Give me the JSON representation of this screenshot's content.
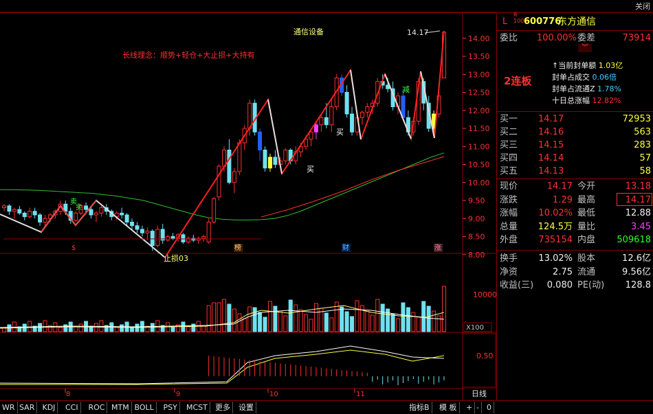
{
  "window": {
    "close_label": "关闭"
  },
  "chart": {
    "sector_label": "通信设备",
    "philosophy_label": "长线理念：顺势+轻仓+大止损+大持有",
    "price_max_label": "14.17",
    "stop_loss_label": "止损03",
    "buy_label_1": "买",
    "buy_label_2": "买",
    "reduce_label": "减",
    "sell_label_1": "卖",
    "sell_label_2": "卖",
    "event_markers": [
      "$",
      "榜",
      "财",
      "涨"
    ],
    "y_ticks": [
      "14.00",
      "13.50",
      "13.00",
      "12.50",
      "12.00",
      "11.50",
      "11.00",
      "10.50",
      "10.00",
      "9.50",
      "9.00",
      "8.50",
      "8.00"
    ],
    "x_ticks": [
      "8",
      "9",
      "10",
      "11"
    ],
    "vol_tick": "10000",
    "vol_unit": "X100",
    "ind_tick": "0.50",
    "period_label": "日线"
  },
  "chart_data": {
    "type": "candlestick",
    "ylim": [
      7.9,
      14.3
    ],
    "candles": [
      [
        9.3,
        9.4,
        9.2,
        9.35
      ],
      [
        9.35,
        9.4,
        9.1,
        9.2
      ],
      [
        9.2,
        9.3,
        9.0,
        9.25
      ],
      [
        9.25,
        9.35,
        9.1,
        9.15
      ],
      [
        9.15,
        9.2,
        8.95,
        9.05
      ],
      [
        9.05,
        9.3,
        9.0,
        9.2
      ],
      [
        9.2,
        9.3,
        9.0,
        9.1
      ],
      [
        9.1,
        9.15,
        8.8,
        8.9
      ],
      [
        8.9,
        9.1,
        8.75,
        9.0
      ],
      [
        9.0,
        9.15,
        8.9,
        9.1
      ],
      [
        9.1,
        9.25,
        9.0,
        9.2
      ],
      [
        9.2,
        9.5,
        9.1,
        9.4
      ],
      [
        9.4,
        9.5,
        9.1,
        9.2
      ],
      [
        9.2,
        9.3,
        8.85,
        8.95
      ],
      [
        8.95,
        9.2,
        8.9,
        9.15
      ],
      [
        9.15,
        9.4,
        9.1,
        9.35
      ],
      [
        9.35,
        9.45,
        9.15,
        9.25
      ],
      [
        9.25,
        9.35,
        9.0,
        9.1
      ],
      [
        9.1,
        9.2,
        8.9,
        9.15
      ],
      [
        9.15,
        9.35,
        9.05,
        9.3
      ],
      [
        9.3,
        9.4,
        9.1,
        9.2
      ],
      [
        9.2,
        9.25,
        8.95,
        9.05
      ],
      [
        9.05,
        9.2,
        8.95,
        9.15
      ],
      [
        9.15,
        9.3,
        9.0,
        9.1
      ],
      [
        9.1,
        9.15,
        8.8,
        8.9
      ],
      [
        8.9,
        9.0,
        8.7,
        8.8
      ],
      [
        8.8,
        8.9,
        8.6,
        8.7
      ],
      [
        8.7,
        8.8,
        8.5,
        8.6
      ],
      [
        8.6,
        8.75,
        8.4,
        8.65
      ],
      [
        8.65,
        8.7,
        8.1,
        8.25
      ],
      [
        8.25,
        8.8,
        8.2,
        8.7
      ],
      [
        8.7,
        8.85,
        8.3,
        8.4
      ],
      [
        8.4,
        8.55,
        8.35,
        8.5
      ],
      [
        8.5,
        8.6,
        8.4,
        8.45
      ],
      [
        8.45,
        8.6,
        8.35,
        8.55
      ],
      [
        8.55,
        8.6,
        8.3,
        8.35
      ],
      [
        8.35,
        8.5,
        8.3,
        8.45
      ],
      [
        8.45,
        8.55,
        8.35,
        8.4
      ],
      [
        8.4,
        8.5,
        8.3,
        8.45
      ],
      [
        8.45,
        8.55,
        8.35,
        8.5
      ],
      [
        8.35,
        9.0,
        8.3,
        8.9
      ],
      [
        8.9,
        9.6,
        8.85,
        9.55
      ],
      [
        9.6,
        10.5,
        9.5,
        10.45
      ],
      [
        10.45,
        11.0,
        10.3,
        10.9
      ],
      [
        10.9,
        11.2,
        9.95,
        10.0
      ],
      [
        10.0,
        10.4,
        9.7,
        10.3
      ],
      [
        10.3,
        11.2,
        10.2,
        11.1
      ],
      [
        11.1,
        11.6,
        10.9,
        11.5
      ],
      [
        11.5,
        12.3,
        11.3,
        12.2
      ],
      [
        12.2,
        12.3,
        11.3,
        11.4
      ],
      [
        11.4,
        11.5,
        10.6,
        10.9
      ],
      [
        10.9,
        11.0,
        10.3,
        10.4
      ],
      [
        10.4,
        10.8,
        10.3,
        10.7
      ],
      [
        10.7,
        10.9,
        10.4,
        10.5
      ],
      [
        10.5,
        10.7,
        10.4,
        10.6
      ],
      [
        10.6,
        10.95,
        10.5,
        10.9
      ],
      [
        10.9,
        10.95,
        10.5,
        10.6
      ],
      [
        10.6,
        11.0,
        10.5,
        10.85
      ],
      [
        10.85,
        11.1,
        10.7,
        11.0
      ],
      [
        11.0,
        11.3,
        10.9,
        11.2
      ],
      [
        11.2,
        11.5,
        11.0,
        11.4
      ],
      [
        11.4,
        11.7,
        11.2,
        11.6
      ],
      [
        11.6,
        11.9,
        11.4,
        11.8
      ],
      [
        11.8,
        12.2,
        11.5,
        11.6
      ],
      [
        11.6,
        12.3,
        11.4,
        12.1
      ],
      [
        12.1,
        13.0,
        12.0,
        12.9
      ],
      [
        12.9,
        13.0,
        12.4,
        12.5
      ],
      [
        12.5,
        12.7,
        11.8,
        11.9
      ],
      [
        11.9,
        12.1,
        11.3,
        11.4
      ],
      [
        11.4,
        11.9,
        11.3,
        11.8
      ],
      [
        11.8,
        12.0,
        11.6,
        11.95
      ],
      [
        11.95,
        12.2,
        11.8,
        12.1
      ],
      [
        12.1,
        12.3,
        11.9,
        12.2
      ],
      [
        12.2,
        12.9,
        12.1,
        12.8
      ],
      [
        12.8,
        13.0,
        12.6,
        12.7
      ],
      [
        12.7,
        12.9,
        12.5,
        12.6
      ],
      [
        12.6,
        12.8,
        12.0,
        12.1
      ],
      [
        12.1,
        12.5,
        11.9,
        12.4
      ],
      [
        12.4,
        12.6,
        11.7,
        11.8
      ],
      [
        11.8,
        12.0,
        11.3,
        11.4
      ],
      [
        11.4,
        11.8,
        11.3,
        11.7
      ],
      [
        11.7,
        12.9,
        11.6,
        12.8
      ],
      [
        12.8,
        12.9,
        12.0,
        12.2
      ],
      [
        12.2,
        12.4,
        11.4,
        11.5
      ],
      [
        11.5,
        12.0,
        11.3,
        11.9
      ],
      [
        11.9,
        12.5,
        11.8,
        12.4
      ],
      [
        12.9,
        14.17,
        12.9,
        14.17
      ]
    ],
    "ma_slow": [
      9.8,
      9.8,
      9.79,
      9.78,
      9.76,
      9.74,
      9.72,
      9.7,
      9.66,
      9.62,
      9.56,
      9.5,
      9.4,
      9.3,
      9.2,
      9.1,
      9.02,
      8.98,
      8.96,
      8.96,
      8.97,
      9.0,
      9.08,
      9.2,
      9.35,
      9.5,
      9.65,
      9.8,
      9.95,
      10.1,
      10.25,
      10.4,
      10.55,
      10.7,
      10.82
    ],
    "ma_fast": [
      9.6,
      9.55,
      9.45,
      9.35,
      9.25,
      9.12,
      9.0,
      8.93,
      8.9,
      8.92
    ]
  }
}
